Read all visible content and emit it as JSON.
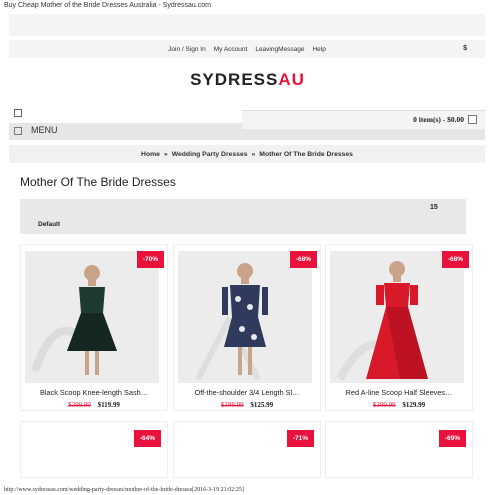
{
  "browser": {
    "page_title": "Buy Cheap Mother of the Bride Dresses Australia - Sydressau.com",
    "footer": "http://www.sydressau.com/wedding-party-dresses/mother-of-the-bride-dresses[2016-3-19 21:02:25]"
  },
  "topbar": {
    "links": [
      "Join / Sign In",
      "My Account",
      "LeavingMessage",
      "Help"
    ],
    "lang_icon": "$"
  },
  "logo": {
    "part1": "SYDRESS",
    "part2": "AU"
  },
  "cart": {
    "label": "0 item(s) - $0.00"
  },
  "menu": {
    "label": "MENU"
  },
  "breadcrumb": {
    "home": "Home",
    "sep": "»",
    "level1": "Wedding Party Dresses",
    "level2": "Mother Of The Bride Dresses"
  },
  "page": {
    "title": "Mother Of The Bride Dresses"
  },
  "sort": {
    "count": "15",
    "selected": "Default"
  },
  "products": [
    {
      "badge": "-70%",
      "name": "Black Scoop Knee-length Sash…",
      "old_price": "$399.99",
      "price": "$119.99",
      "dress_color": "#1f3a33",
      "accent": "#0d1b18"
    },
    {
      "badge": "-68%",
      "name": "Off-the-shoulder 3/4 Length Sl…",
      "old_price": "$398.99",
      "price": "$125.99",
      "dress_color": "#2f3a5c",
      "accent": "#e8e8f0"
    },
    {
      "badge": "-68%",
      "name": "Red A-line Scoop Half Sleeves…",
      "old_price": "$399.99",
      "price": "$129.99",
      "dress_color": "#d8192a",
      "accent": "#b01020"
    }
  ],
  "products_row2": [
    {
      "badge": "-64%"
    },
    {
      "badge": "-71%"
    },
    {
      "badge": "-69%"
    }
  ]
}
